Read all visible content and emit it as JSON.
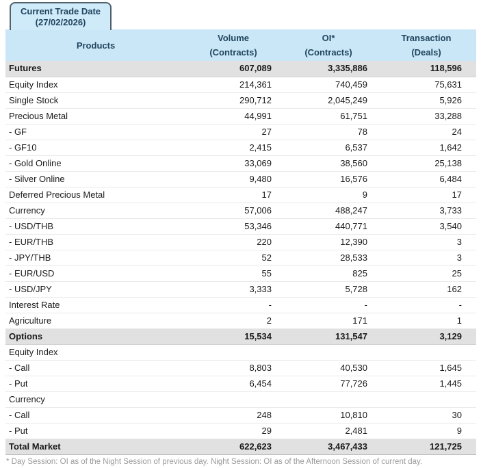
{
  "tab": {
    "line1": "Current Trade Date",
    "line2": "(27/02/2026)"
  },
  "table": {
    "header": {
      "products": "Products",
      "columns": [
        {
          "label": "Volume",
          "sub": "(Contracts)"
        },
        {
          "label": "OI*",
          "sub": "(Contracts)"
        },
        {
          "label": "Transaction",
          "sub": "(Deals)"
        }
      ]
    },
    "rows": [
      {
        "type": "section",
        "product": "Futures",
        "volume": "607,089",
        "oi": "3,335,886",
        "deals": "118,596"
      },
      {
        "type": "normal",
        "product": "Equity Index",
        "volume": "214,361",
        "oi": "740,459",
        "deals": "75,631"
      },
      {
        "type": "normal",
        "product": "Single Stock",
        "volume": "290,712",
        "oi": "2,045,249",
        "deals": "5,926"
      },
      {
        "type": "normal",
        "product": "Precious Metal",
        "volume": "44,991",
        "oi": "61,751",
        "deals": "33,288"
      },
      {
        "type": "normal",
        "product": "- GF",
        "volume": "27",
        "oi": "78",
        "deals": "24"
      },
      {
        "type": "normal",
        "product": "- GF10",
        "volume": "2,415",
        "oi": "6,537",
        "deals": "1,642"
      },
      {
        "type": "normal",
        "product": "- Gold Online",
        "volume": "33,069",
        "oi": "38,560",
        "deals": "25,138"
      },
      {
        "type": "normal",
        "product": "- Silver Online",
        "volume": "9,480",
        "oi": "16,576",
        "deals": "6,484"
      },
      {
        "type": "normal",
        "product": "Deferred Precious Metal",
        "volume": "17",
        "oi": "9",
        "deals": "17"
      },
      {
        "type": "normal",
        "product": "Currency",
        "volume": "57,006",
        "oi": "488,247",
        "deals": "3,733"
      },
      {
        "type": "normal",
        "product": "- USD/THB",
        "volume": "53,346",
        "oi": "440,771",
        "deals": "3,540"
      },
      {
        "type": "normal",
        "product": "- EUR/THB",
        "volume": "220",
        "oi": "12,390",
        "deals": "3"
      },
      {
        "type": "normal",
        "product": "- JPY/THB",
        "volume": "52",
        "oi": "28,533",
        "deals": "3"
      },
      {
        "type": "normal",
        "product": "- EUR/USD",
        "volume": "55",
        "oi": "825",
        "deals": "25"
      },
      {
        "type": "normal",
        "product": "- USD/JPY",
        "volume": "3,333",
        "oi": "5,728",
        "deals": "162"
      },
      {
        "type": "normal",
        "product": "Interest Rate",
        "volume": "-",
        "oi": "-",
        "deals": "-"
      },
      {
        "type": "normal",
        "product": "Agriculture",
        "volume": "2",
        "oi": "171",
        "deals": "1"
      },
      {
        "type": "section",
        "product": "Options",
        "volume": "15,534",
        "oi": "131,547",
        "deals": "3,129"
      },
      {
        "type": "normal",
        "product": "Equity Index",
        "volume": "",
        "oi": "",
        "deals": ""
      },
      {
        "type": "normal",
        "product": "- Call",
        "volume": "8,803",
        "oi": "40,530",
        "deals": "1,645"
      },
      {
        "type": "normal",
        "product": "- Put",
        "volume": "6,454",
        "oi": "77,726",
        "deals": "1,445"
      },
      {
        "type": "normal",
        "product": "Currency",
        "volume": "",
        "oi": "",
        "deals": ""
      },
      {
        "type": "normal",
        "product": "- Call",
        "volume": "248",
        "oi": "10,810",
        "deals": "30"
      },
      {
        "type": "normal",
        "product": "- Put",
        "volume": "29",
        "oi": "2,481",
        "deals": "9"
      },
      {
        "type": "section",
        "product": "Total Market",
        "volume": "622,623",
        "oi": "3,467,433",
        "deals": "121,725"
      }
    ]
  },
  "footnote": "* Day Session: OI as of the Night Session of previous day. Night Session: OI as of the Afternoon Session of current day.",
  "colors": {
    "header_bg": "#c9e7f6",
    "tab_bg": "#cfeaf8",
    "tab_border": "#51626f",
    "header_text": "#21455f",
    "section_row_bg": "#e1e1e1",
    "row_divider": "#e9e9e9",
    "footnote_text": "#9b9b9b"
  }
}
